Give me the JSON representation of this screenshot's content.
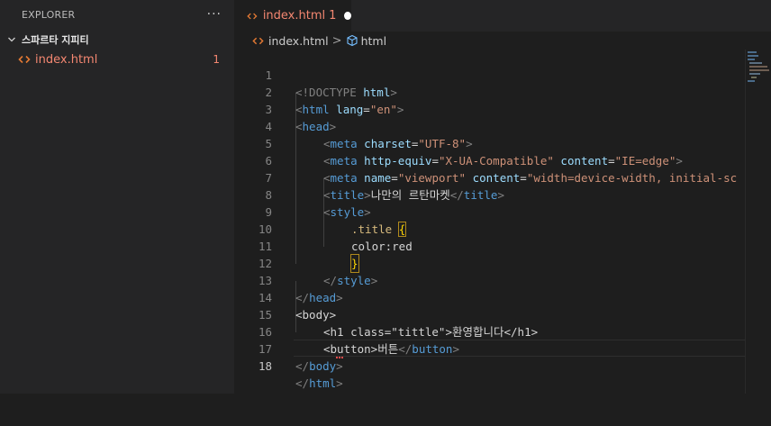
{
  "explorer": {
    "title": "EXPLORER",
    "more_label": "···",
    "folder": "스파르타 지피티",
    "files": [
      {
        "name": "index.html",
        "problems": "1"
      }
    ]
  },
  "tab": {
    "label": "index.html",
    "problems": "1"
  },
  "breadcrumb": {
    "file": "index.html",
    "separator": ">",
    "symbol": "html"
  },
  "code": {
    "line_numbers": [
      "1",
      "2",
      "3",
      "4",
      "5",
      "6",
      "7",
      "8",
      "9",
      "10",
      "11",
      "12",
      "13",
      "14",
      "15",
      "16",
      "17",
      "18"
    ],
    "active_line": "18",
    "l1": {
      "a": "<!DOCTYPE",
      "b": " html",
      "c": ">"
    },
    "l2": {
      "a": "<",
      "b": "html",
      "c": " lang",
      "d": "=",
      "e": "\"en\"",
      "f": ">"
    },
    "l3": {
      "a": "<",
      "b": "head",
      "c": ">"
    },
    "l4": {
      "a": "<",
      "b": "meta",
      "c": " charset",
      "d": "=",
      "e": "\"UTF-8\"",
      "f": ">"
    },
    "l5": {
      "a": "<",
      "b": "meta",
      "c": " http-equiv",
      "d": "=",
      "e": "\"X-UA-Compatible\"",
      "f": " content",
      "g": "=",
      "h": "\"IE=edge\"",
      "i": ">"
    },
    "l6": {
      "a": "<",
      "b": "meta",
      "c": " name",
      "d": "=",
      "e": "\"viewport\"",
      "f": " content",
      "g": "=",
      "h": "\"width=device-width, initial-sc"
    },
    "l7": {
      "a": "<",
      "b": "title",
      "c": ">",
      "d": "나만의 르탄마켓",
      "e": "</",
      "f": "title",
      "g": ">"
    },
    "l8": {
      "a": "<",
      "b": "style",
      "c": ">"
    },
    "l9": {
      "a": ".title",
      "b": " ",
      "c": "{"
    },
    "l10": {
      "a": "color:red"
    },
    "l11": {
      "a": "}"
    },
    "l12": {
      "a": "</",
      "b": "style",
      "c": ">"
    },
    "l13": {
      "a": "</",
      "b": "head",
      "c": ">"
    },
    "l14": {
      "a": "<body>"
    },
    "l15": {
      "a": "<h1 class=\"tittle\">환영합니다</h1>"
    },
    "l16": {
      "a": "<button>",
      "b": "버튼",
      "c": "</",
      "d": "button",
      "e": ">"
    },
    "l17": {
      "a": "</",
      "b": "body",
      "c": ">"
    },
    "l18": {
      "a": "</",
      "b": "html",
      "c": ">"
    }
  },
  "colors": {
    "tag": "#569cd6",
    "attribute": "#9cdcfe",
    "string": "#ce9178",
    "text": "#d4d4d4",
    "problem": "#f48771",
    "bracket_match": "#b08a1c"
  },
  "icons": [
    "chevron-down-icon",
    "html-code-icon",
    "symbol-cube-icon",
    "more-icon",
    "dirty-dot-icon"
  ]
}
